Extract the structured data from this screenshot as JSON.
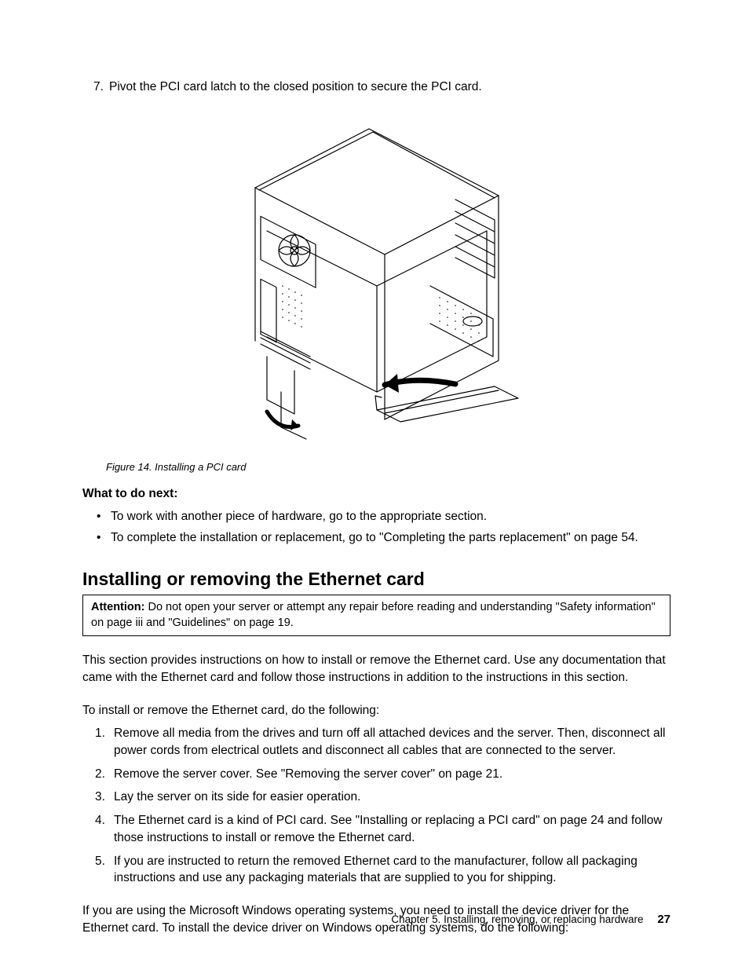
{
  "step7": {
    "num": "7.",
    "text": "Pivot the PCI card latch to the closed position to secure the PCI card."
  },
  "figure": {
    "caption": "Figure 14.  Installing a PCI card",
    "alt": "Line drawing of an open tower server case showing a PCI card being inserted and the rear latch being pivoted closed."
  },
  "what_next": {
    "heading": "What to do next:",
    "items": [
      "To work with another piece of hardware, go to the appropriate section.",
      "To complete the installation or replacement, go to \"Completing the parts replacement\" on page 54."
    ]
  },
  "section": {
    "heading": "Installing or removing the Ethernet card",
    "attention_label": "Attention:",
    "attention_text": " Do not open your server or attempt any repair before reading and understanding \"Safety information\" on page iii and \"Guidelines\" on page 19.",
    "intro": "This section provides instructions on how to install or remove the Ethernet card. Use any documentation that came with the Ethernet card and follow those instructions in addition to the instructions in this section.",
    "lead": "To install or remove the Ethernet card, do the following:",
    "steps": [
      "Remove all media from the drives and turn off all attached devices and the server. Then, disconnect all power cords from electrical outlets and disconnect all cables that are connected to the server.",
      "Remove the server cover. See \"Removing the server cover\" on page 21.",
      "Lay the server on its side for easier operation.",
      "The Ethernet card is a kind of PCI card. See \"Installing or replacing a PCI card\" on page 24 and follow those instructions to install or remove the Ethernet card.",
      "If you are instructed to return the removed Ethernet card to the manufacturer, follow all packaging instructions and use any packaging materials that are supplied to you for shipping."
    ],
    "closing": "If you are using the Microsoft Windows operating systems, you need to install the device driver for the Ethernet card. To install the device driver on Windows operating systems, do the following:"
  },
  "footer": {
    "chapter": "Chapter 5. Installing, removing, or replacing hardware",
    "page": "27"
  }
}
